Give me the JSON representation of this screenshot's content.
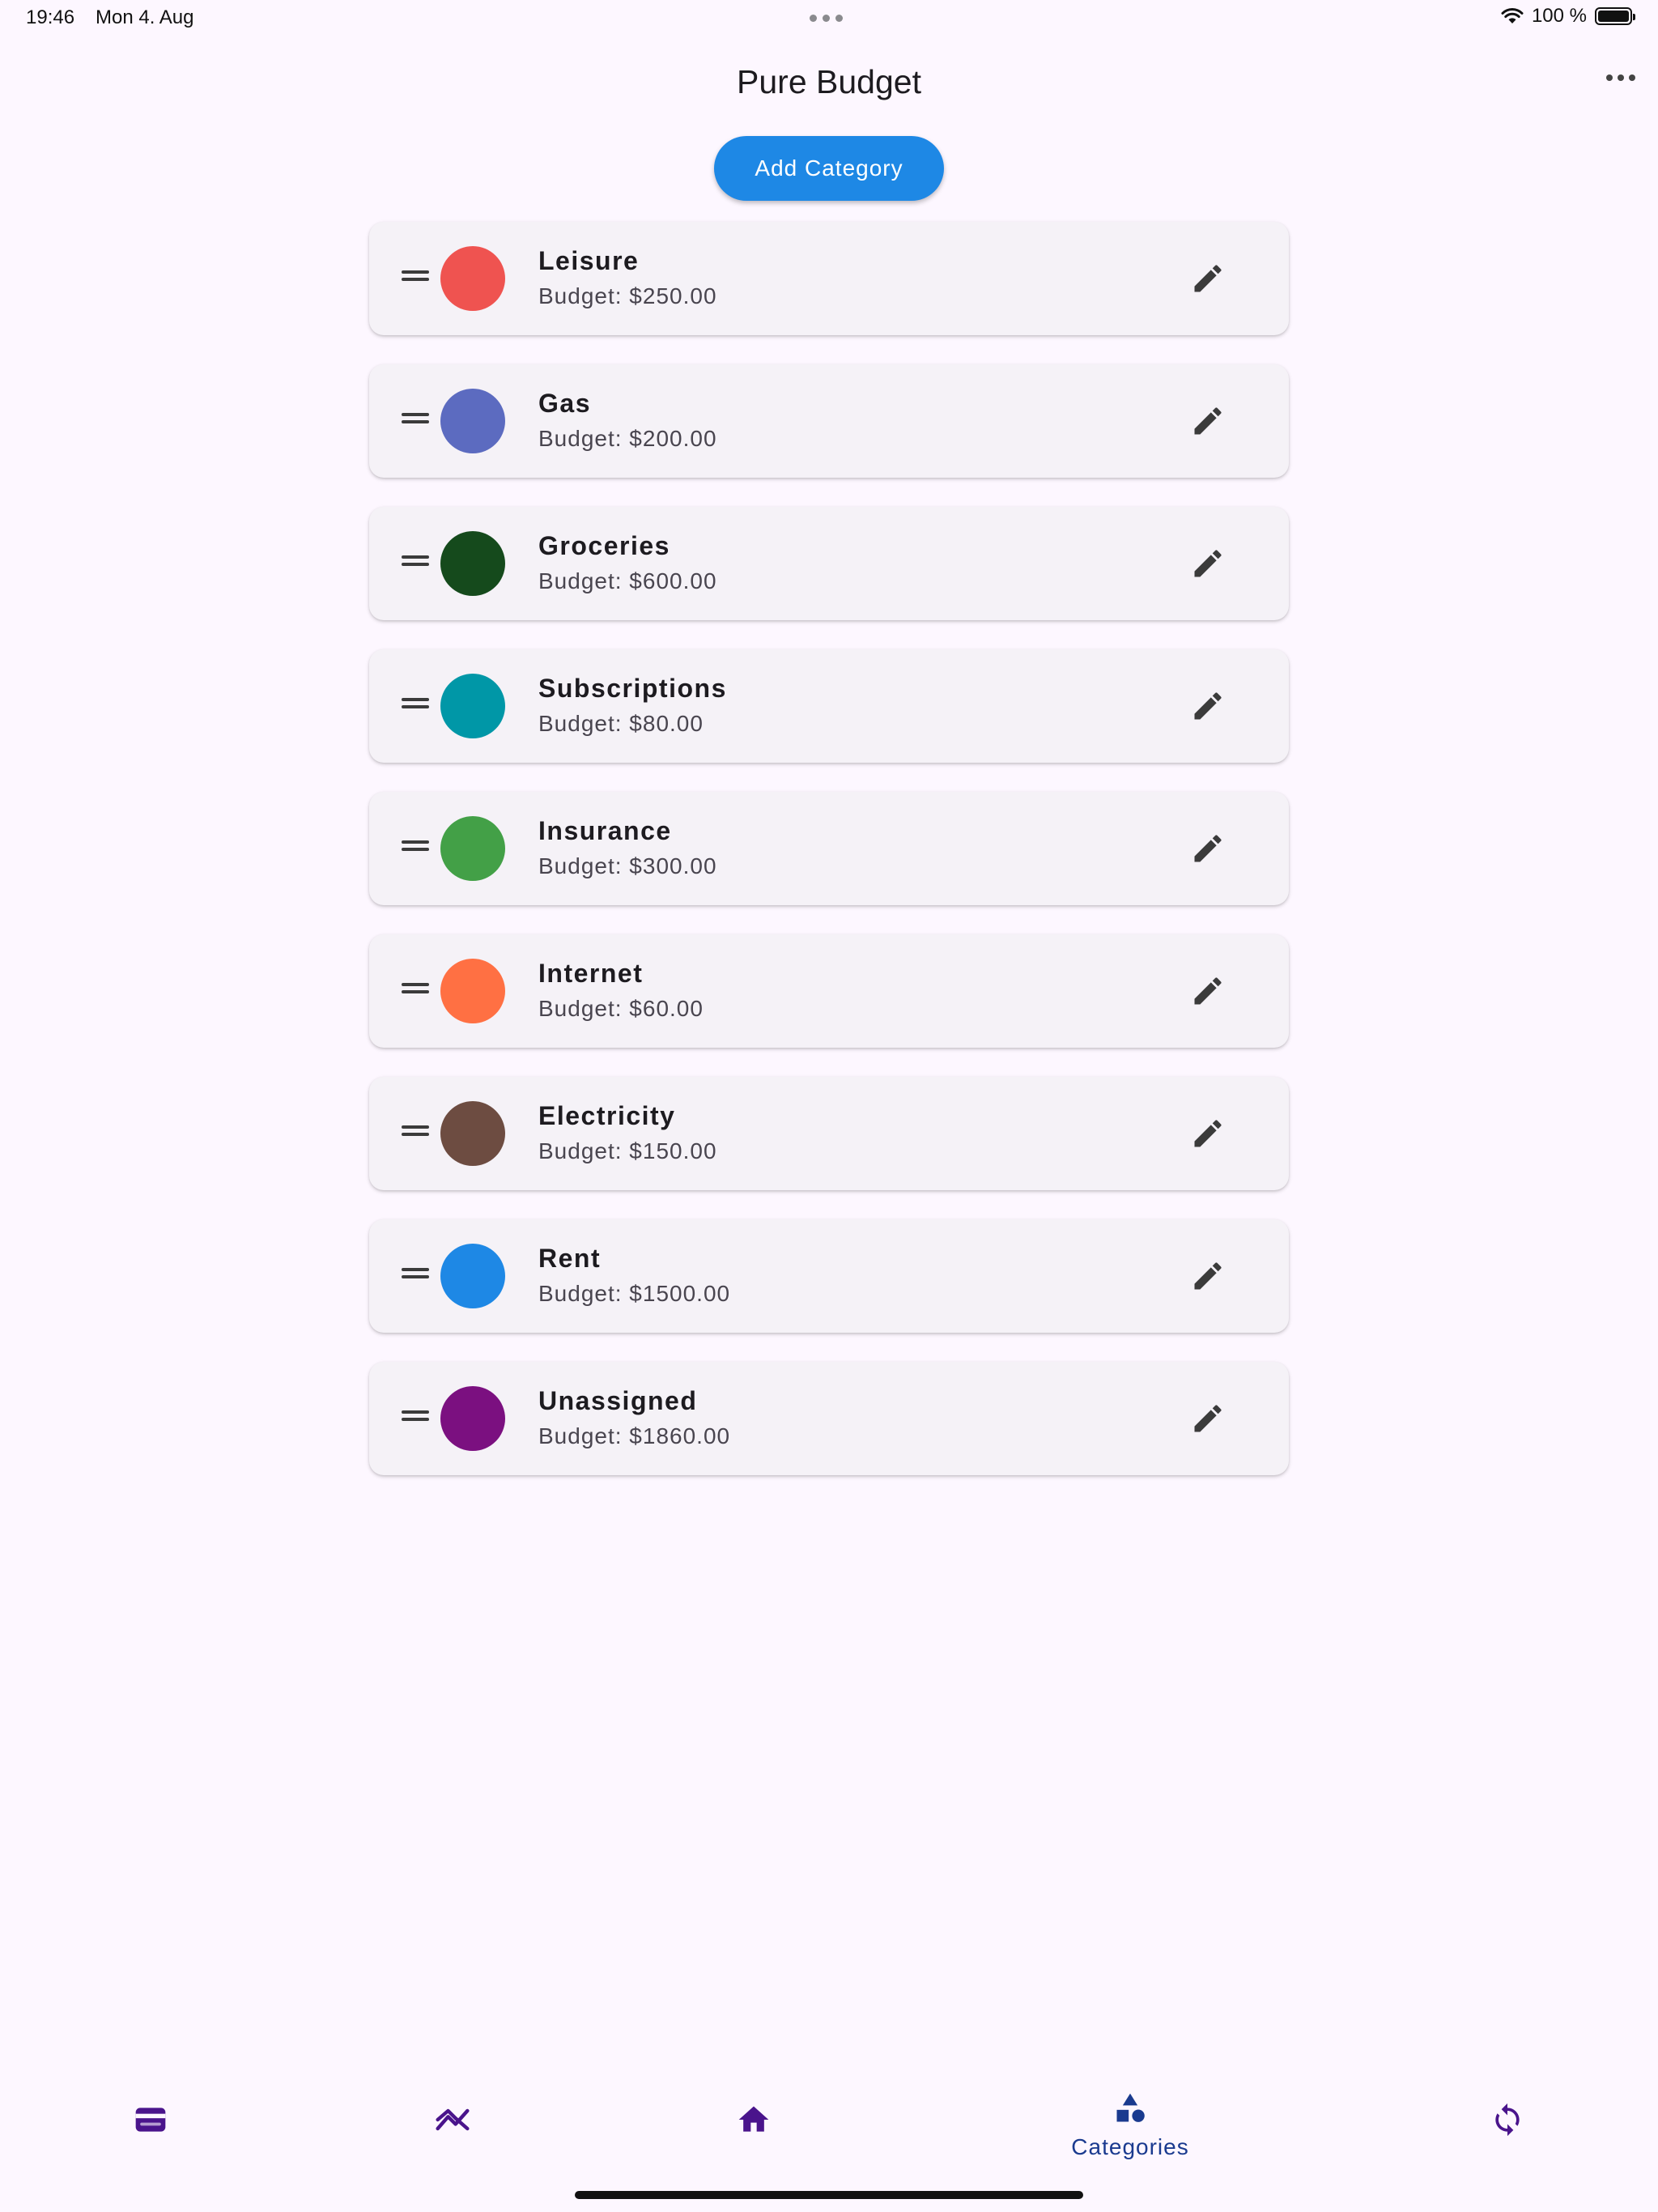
{
  "status_bar": {
    "time": "19:46",
    "date": "Mon 4. Aug",
    "battery": "100 %"
  },
  "header": {
    "title": "Pure Budget",
    "more_icon": "more-horizontal-icon"
  },
  "actions": {
    "add_category_label": "Add Category"
  },
  "categories": [
    {
      "name": "Leisure",
      "budget": "Budget: $250.00",
      "color": "#ef5350"
    },
    {
      "name": "Gas",
      "budget": "Budget: $200.00",
      "color": "#5c6bc0"
    },
    {
      "name": "Groceries",
      "budget": "Budget: $600.00",
      "color": "#154a1c"
    },
    {
      "name": "Subscriptions",
      "budget": "Budget: $80.00",
      "color": "#0097a7"
    },
    {
      "name": "Insurance",
      "budget": "Budget: $300.00",
      "color": "#43a047"
    },
    {
      "name": "Internet",
      "budget": "Budget: $60.00",
      "color": "#ff7043"
    },
    {
      "name": "Electricity",
      "budget": "Budget: $150.00",
      "color": "#6d4c41"
    },
    {
      "name": "Rent",
      "budget": "Budget: $1500.00",
      "color": "#1e88e5"
    },
    {
      "name": "Unassigned",
      "budget": "Budget: $1860.00",
      "color": "#7b1080"
    }
  ],
  "bottom_nav": {
    "items": [
      {
        "icon": "wallet-icon",
        "label": ""
      },
      {
        "icon": "trending-icon",
        "label": ""
      },
      {
        "icon": "home-icon",
        "label": ""
      },
      {
        "icon": "category-shapes-icon",
        "label": "Categories",
        "active": true
      },
      {
        "icon": "sync-icon",
        "label": ""
      }
    ],
    "active_color": "#1a3a8f",
    "inactive_color": "#4a148c"
  },
  "colors": {
    "background": "#fdf7ff",
    "card": "#f5f2f7",
    "accent": "#1e88e5"
  }
}
